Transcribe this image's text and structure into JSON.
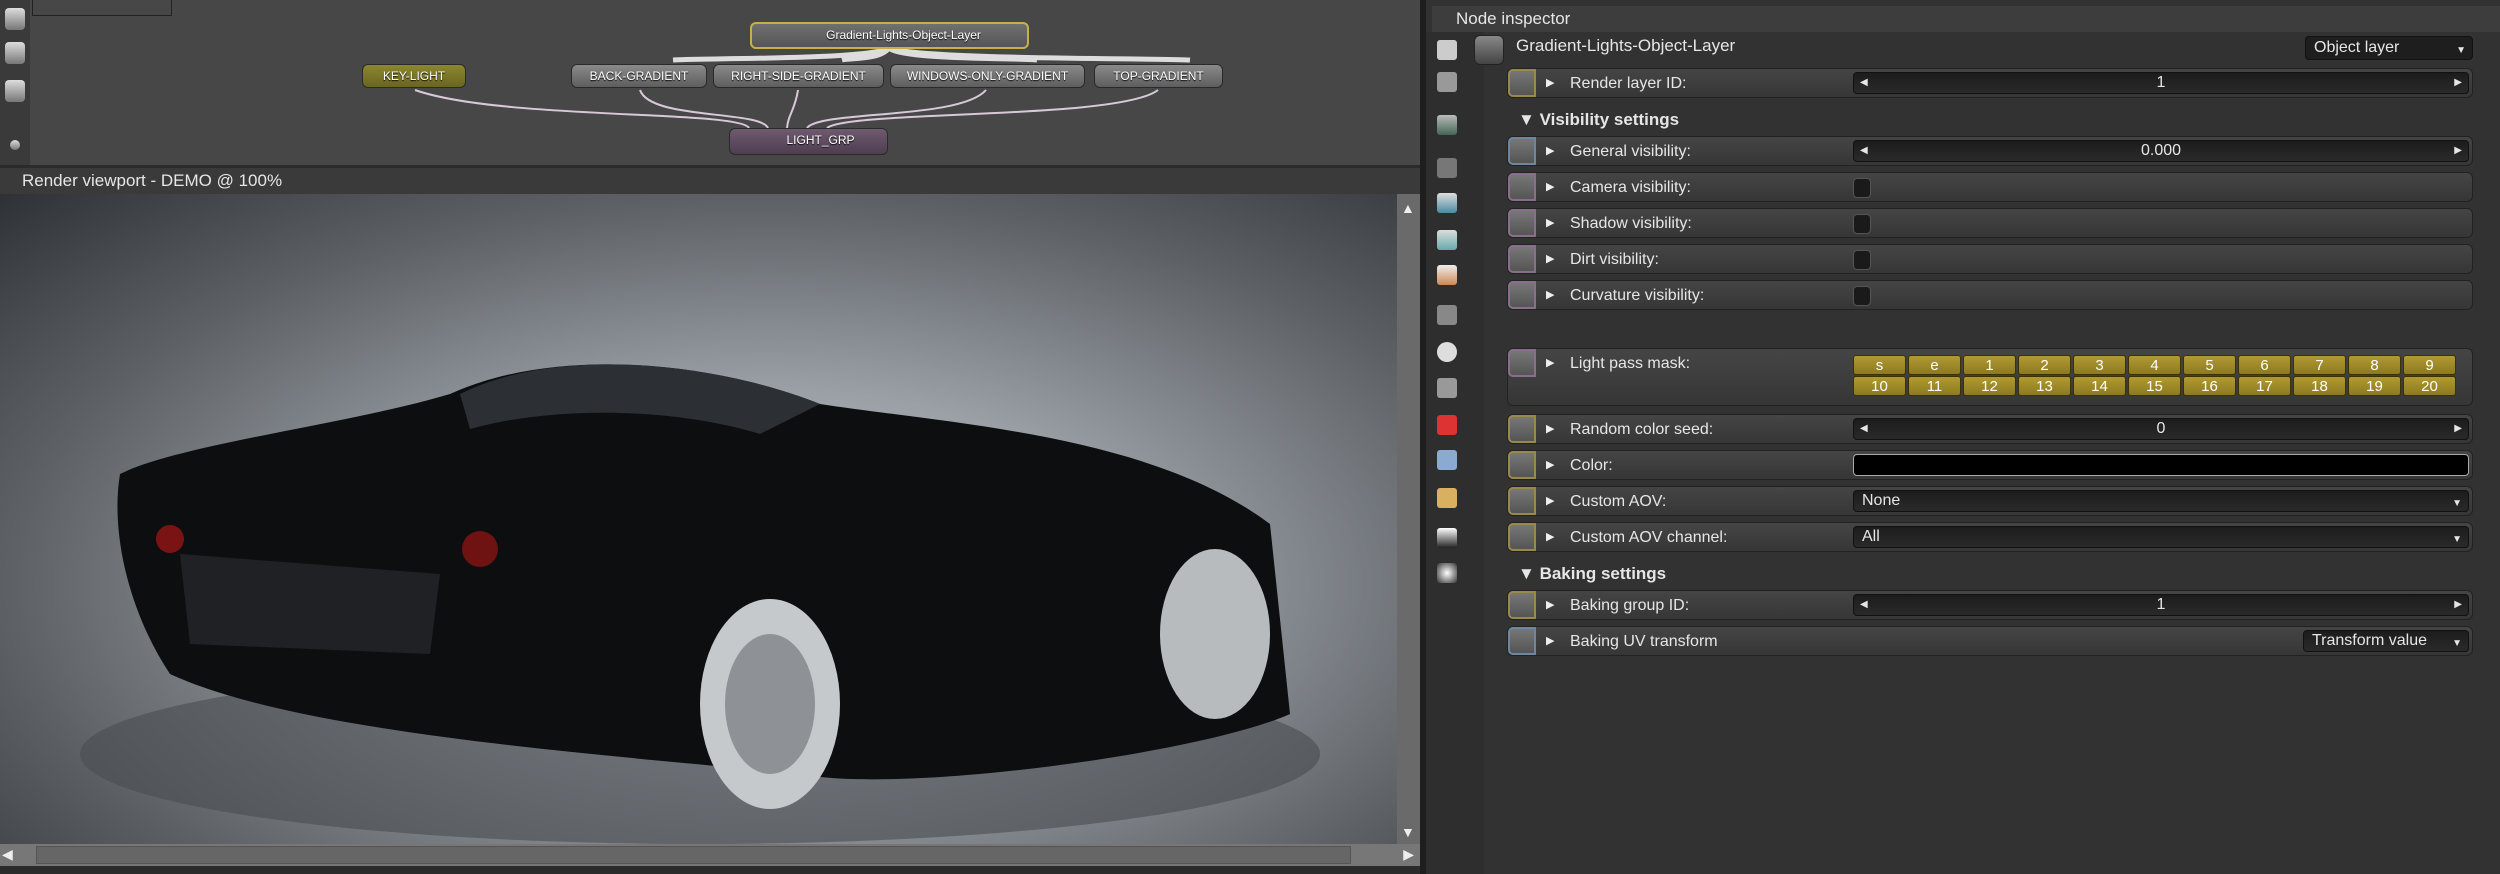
{
  "graph": {
    "nodes": {
      "object_layer": "Gradient-Lights-Object-Layer",
      "key_light": "KEY-LIGHT",
      "back": "BACK-GRADIENT",
      "right_side": "RIGHT-SIDE-GRADIENT",
      "windows": "WINDOWS-ONLY-GRADIENT",
      "top": "TOP-GRADIENT",
      "light_grp": "LIGHT_GRP"
    }
  },
  "viewport": {
    "title": "Render viewport - DEMO @ 100%"
  },
  "inspector": {
    "title": "Node inspector",
    "node_name": "Gradient-Lights-Object-Layer",
    "node_type": "Object layer",
    "render_layer_id": {
      "label": "Render layer ID:",
      "value": "1"
    },
    "visibility_section": "Visibility settings",
    "general_visibility": {
      "label": "General visibility:",
      "value": "0.000"
    },
    "camera_visibility": {
      "label": "Camera visibility:",
      "checked": false
    },
    "shadow_visibility": {
      "label": "Shadow visibility:",
      "checked": false
    },
    "dirt_visibility": {
      "label": "Dirt visibility:",
      "checked": false
    },
    "curvature_visibility": {
      "label": "Curvature visibility:",
      "checked": false
    },
    "light_pass_mask": {
      "label": "Light pass mask:",
      "row1": [
        "s",
        "e",
        "1",
        "2",
        "3",
        "4",
        "5",
        "6",
        "7",
        "8",
        "9"
      ],
      "row2": [
        "10",
        "11",
        "12",
        "13",
        "14",
        "15",
        "16",
        "17",
        "18",
        "19",
        "20"
      ]
    },
    "random_color_seed": {
      "label": "Random color seed:",
      "value": "0"
    },
    "color": {
      "label": "Color:",
      "value": "#000000"
    },
    "custom_aov": {
      "label": "Custom AOV:",
      "value": "None"
    },
    "custom_aov_channel": {
      "label": "Custom AOV channel:",
      "value": "All"
    },
    "baking_section": "Baking settings",
    "baking_group_id": {
      "label": "Baking group ID:",
      "value": "1"
    },
    "baking_uv_transform": {
      "label": "Baking UV transform",
      "value": "Transform value"
    }
  },
  "colors": {
    "mask_button": "#a89230",
    "accent_gold": "#c8b048"
  }
}
